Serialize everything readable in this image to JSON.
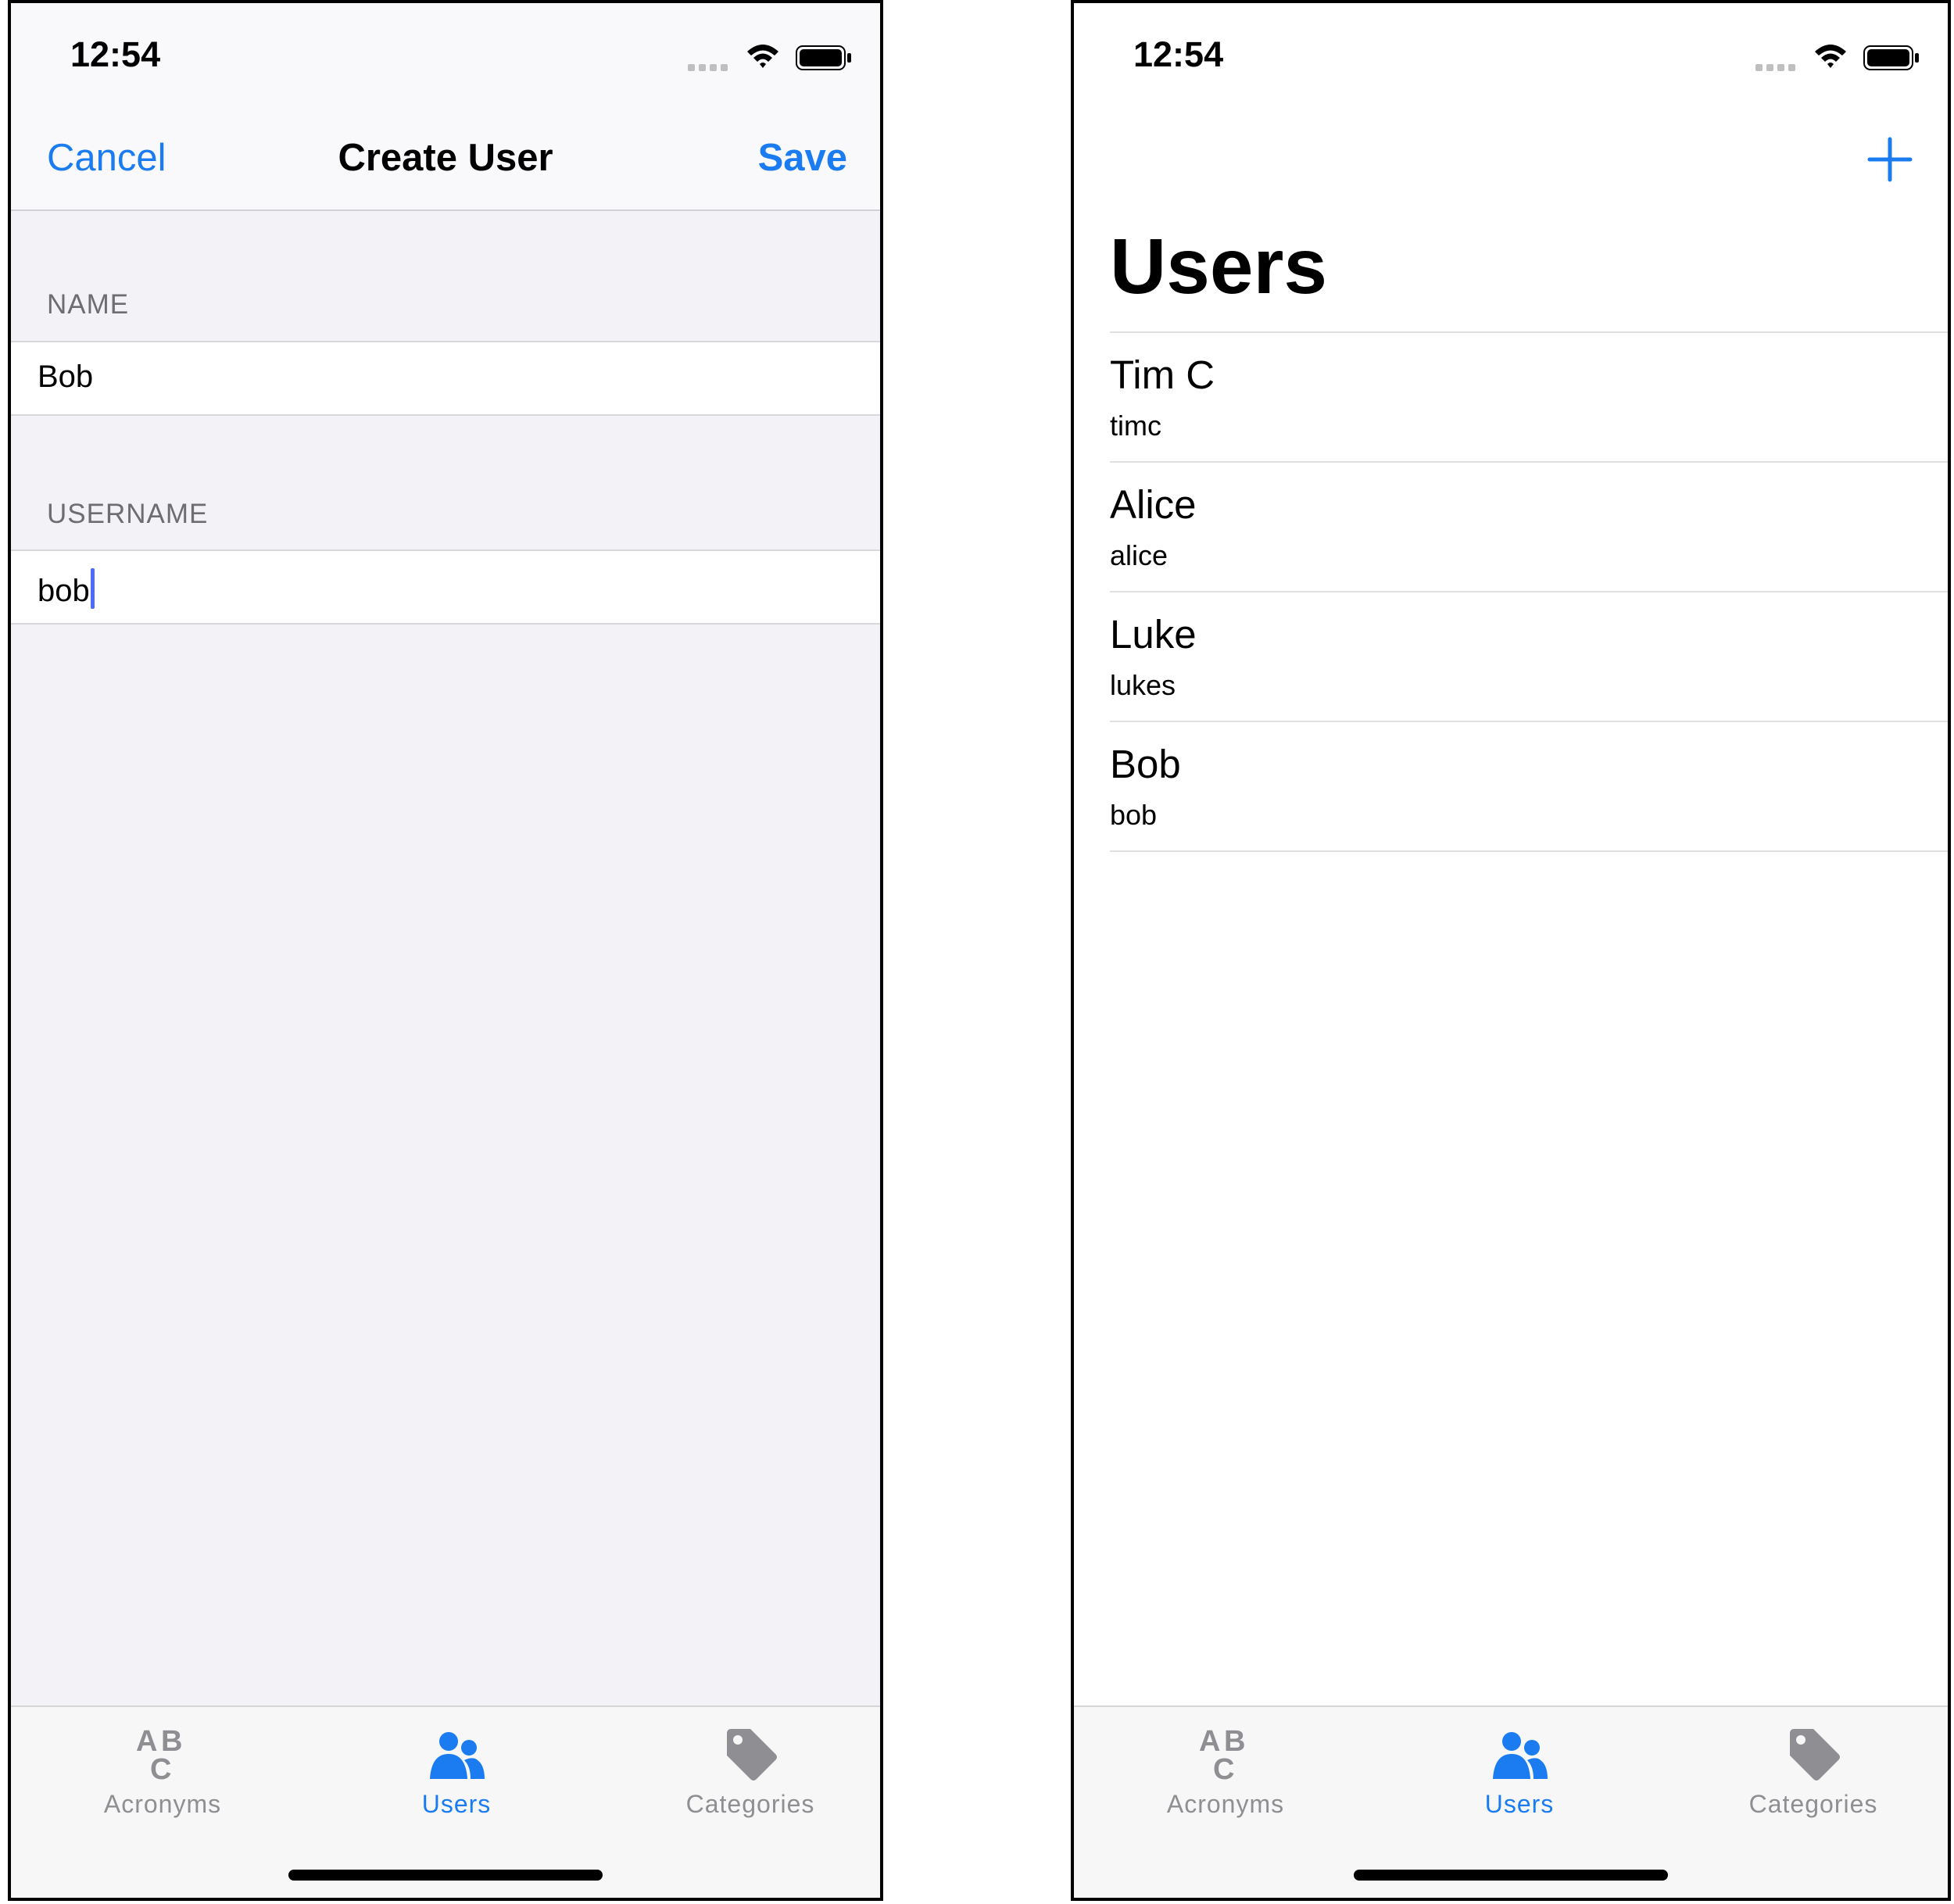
{
  "create_user_screen": {
    "status_time": "12:54",
    "nav": {
      "cancel_label": "Cancel",
      "title": "Create User",
      "save_label": "Save"
    },
    "name_section": {
      "header": "NAME",
      "value": "Bob"
    },
    "username_section": {
      "header": "USERNAME",
      "value": "bob"
    }
  },
  "users_screen": {
    "status_time": "12:54",
    "title": "Users",
    "users": [
      {
        "name": "Tim C",
        "username": "timc"
      },
      {
        "name": "Alice",
        "username": "alice"
      },
      {
        "name": "Luke",
        "username": "lukes"
      },
      {
        "name": "Bob",
        "username": "bob"
      }
    ]
  },
  "tab_bar": {
    "tabs": [
      {
        "label": "Acronyms",
        "icon": "abc-icon",
        "active": false
      },
      {
        "label": "Users",
        "icon": "users-icon",
        "active": true
      },
      {
        "label": "Categories",
        "icon": "tag-icon",
        "active": false
      }
    ]
  },
  "colors": {
    "accent": "#1a7cf0",
    "inactive": "#8e8e93",
    "caret": "#4a6cf7"
  }
}
